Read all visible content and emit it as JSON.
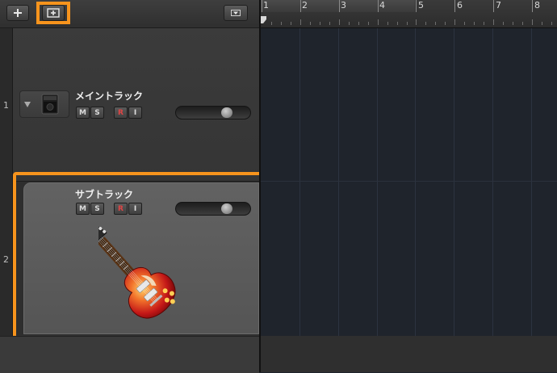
{
  "toolbar": {
    "add_icon": "plus-icon",
    "new_track_icon": "plus-in-box-icon",
    "menu_icon": "triangle-down-icon"
  },
  "tracks": [
    {
      "number": "1",
      "name": "メイントラック",
      "buttons": {
        "mute": "M",
        "solo": "S",
        "record": "R",
        "input": "I"
      },
      "volume_level": 0.72
    },
    {
      "number": "2",
      "name": "サブトラック",
      "buttons": {
        "mute": "M",
        "solo": "S",
        "record": "R",
        "input": "I"
      },
      "volume_level": 0.72
    }
  ],
  "ruler": {
    "bars": [
      "1",
      "2",
      "3",
      "4",
      "5",
      "6",
      "7",
      "8"
    ]
  },
  "colors": {
    "highlight": "#f7941d",
    "record": "#e04545",
    "timeline_bg": "#1f242c"
  }
}
